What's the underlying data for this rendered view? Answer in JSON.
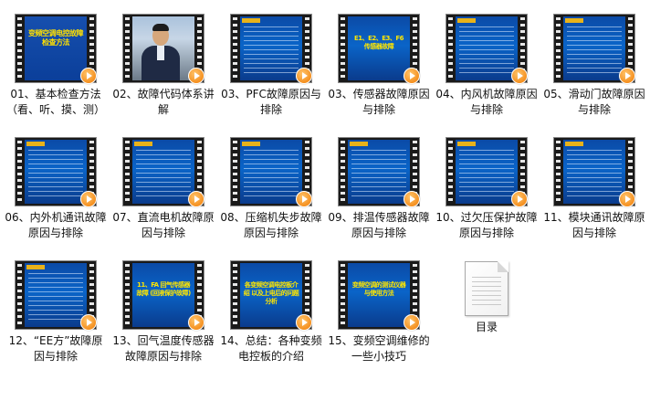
{
  "files": [
    {
      "label": "01、基本检查方法（看、听、摸、测）",
      "thumb": "title",
      "screen_text": "变频空调电控故障检查方法"
    },
    {
      "label": "02、故障代码体系讲解",
      "thumb": "person"
    },
    {
      "label": "03、PFC故障原因与排除",
      "thumb": "text"
    },
    {
      "label": "03、传感器故障原因与排除",
      "thumb": "big",
      "screen_text": "E1、E2、E3、F6 传感器故障"
    },
    {
      "label": "04、内风机故障原因与排除",
      "thumb": "text"
    },
    {
      "label": "05、滑动门故障原因与排除",
      "thumb": "text"
    },
    {
      "label": "06、内外机通讯故障原因与排除",
      "thumb": "text"
    },
    {
      "label": "07、直流电机故障原因与排除",
      "thumb": "text"
    },
    {
      "label": "08、压缩机失步故障原因与排除",
      "thumb": "text"
    },
    {
      "label": "09、排温传感器故障原因与排除",
      "thumb": "text"
    },
    {
      "label": "10、过欠压保护故障原因与排除",
      "thumb": "text"
    },
    {
      "label": "11、模块通讯故障原因与排除",
      "thumb": "text"
    },
    {
      "label": "12、“EE方”故障原因与排除",
      "thumb": "text"
    },
    {
      "label": "13、回气温度传感器故障原因与排除",
      "thumb": "big",
      "screen_text": "11、FA 回气传感器故障 (回液保护故障)"
    },
    {
      "label": "14、总结：各种变频电控板的介绍",
      "thumb": "big",
      "screen_text": "各变频空调电控板介绍 以及上电后的问题分析"
    },
    {
      "label": "15、变频空调维修的一些小技巧",
      "thumb": "big",
      "screen_text": "变频空调的测试仪器与使用方法"
    }
  ],
  "doc_file": {
    "label": "目录"
  }
}
